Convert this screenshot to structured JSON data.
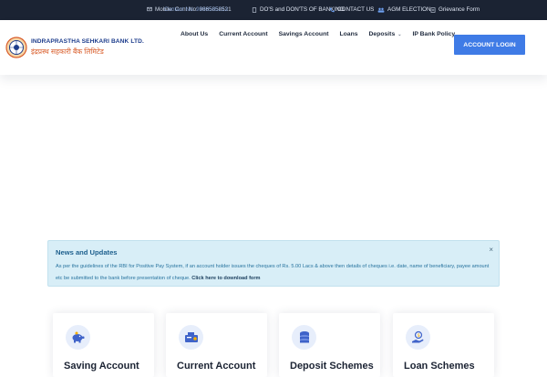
{
  "topbar": {
    "email_text": "IT-Mobile",
    "phone_overlap_a": "Mobile: Cont No: 9865858521",
    "phone_overlap_b": "Contact No: 9898585213",
    "dos_donts": "DO'S and DON'TS OF BANKING",
    "contact": "CONTACT US",
    "agm": "AGM ELECTION",
    "grievance": "Grievance Form"
  },
  "logo": {
    "english": "INDRAPRASTHA SEHKARI BANK LTD.",
    "hindi": "इंद्रप्रस्थ सहकारी बैंक लिमिटेड"
  },
  "nav": {
    "items": [
      "About Us",
      "Current Account",
      "Savings Account",
      "Loans",
      "Deposits",
      "IP Bank Policy"
    ],
    "login": "ACCOUNT LOGIN"
  },
  "news": {
    "title": "News and Updates",
    "body": "As per the guidelines of the RBI for Positive Pay System, if an account holder issues the cheques of Rs. 5.00 Lacs & above then details of cheques i.e. date, name of beneficiary, payee amount etc be submitted to the bank before presentation of cheque.",
    "link": "Click here to download form",
    "close": "×"
  },
  "cards": [
    {
      "title": "Saving Account",
      "icon": "piggy-bank-icon"
    },
    {
      "title": "Current Account",
      "icon": "cash-register-icon"
    },
    {
      "title": "Deposit Schemes",
      "icon": "coin-stack-icon"
    },
    {
      "title": "Loan Schemes",
      "icon": "hand-money-icon"
    }
  ],
  "colors": {
    "topbar": "#1b2333",
    "accent": "#3f7be6",
    "news_bg": "#d8eef7"
  }
}
